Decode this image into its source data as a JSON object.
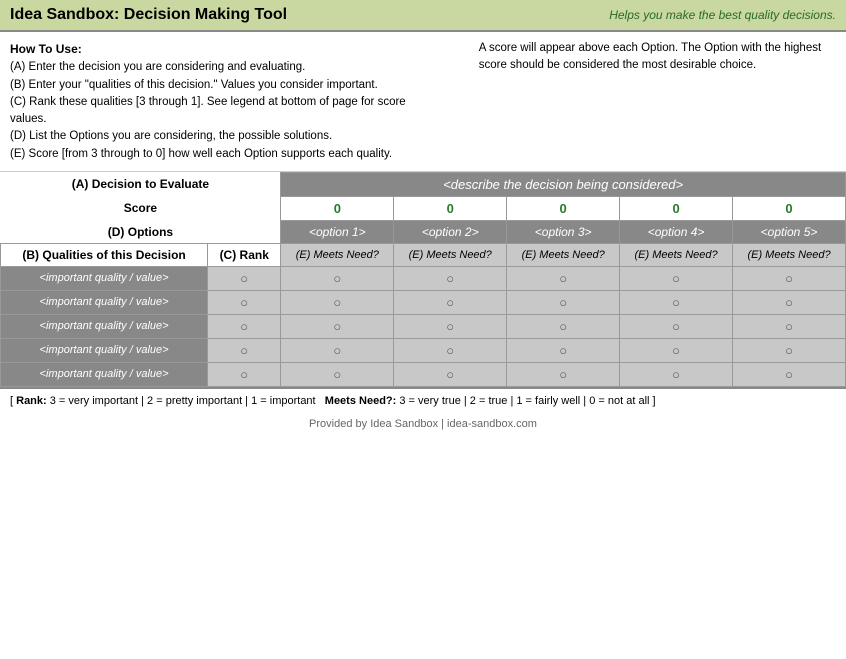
{
  "header": {
    "title": "Idea Sandbox: Decision Making Tool",
    "tagline": "Helps you make the best quality decisions."
  },
  "howToUse": {
    "heading": "How To Use:",
    "steps": [
      "(A) Enter the decision you are considering and evaluating.",
      "(B) Enter your \"qualities of this decision.\" Values you consider important.",
      "(C) Rank these qualities [3 through 1]. See legend at bottom of page for score values.",
      "(D) List the Options you are considering, the possible solutions.",
      "(E) Score [from 3 through to 0] how well each Option supports each quality."
    ],
    "right_text": "A score will appear above each Option. The Option with the highest score should be considered the most desirable choice."
  },
  "labels": {
    "decision": "(A) Decision to Evaluate",
    "score": "Score",
    "options": "(D) Options",
    "qualities": "(B) Qualities of this Decision",
    "rank": "(C) Rank",
    "meets_need": "(E) Meets Need?"
  },
  "decision_placeholder": "<describe the decision being considered>",
  "scores": [
    "0",
    "0",
    "0",
    "0",
    "0"
  ],
  "options": [
    "<option 1>",
    "<option 2>",
    "<option 3>",
    "<option 4>",
    "<option 5>"
  ],
  "qualities": [
    "<important quality / value>",
    "<important quality / value>",
    "<important quality / value>",
    "<important quality / value>",
    "<important quality / value>"
  ],
  "rank_values": [
    "○",
    "○",
    "○",
    "○",
    "○"
  ],
  "data_values": "○",
  "footer": {
    "legend": "[ Rank: 3 = very important | 2 = pretty important | 1 = important",
    "meets_need_legend": "Meets Need?: 3 = very true | 2 = true | 1 = fairly well | 0 = not at all ]",
    "credit": "Provided by Idea Sandbox | idea-sandbox.com"
  }
}
